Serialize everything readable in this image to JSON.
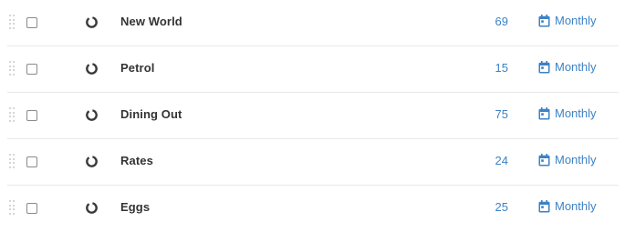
{
  "colors": {
    "accent": "#3d82c4",
    "name_text": "#333333",
    "divider": "#e8e8e8",
    "handle": "#c9c9c9",
    "progress_ring": "#3a3a3a"
  },
  "icons": {
    "drag": "drag-handle-icon",
    "status": "progress-ring-icon",
    "frequency": "calendar-icon"
  },
  "rows": [
    {
      "name": "New World",
      "amount": "69",
      "frequency": "Monthly"
    },
    {
      "name": "Petrol",
      "amount": "15",
      "frequency": "Monthly"
    },
    {
      "name": "Dining Out",
      "amount": "75",
      "frequency": "Monthly"
    },
    {
      "name": "Rates",
      "amount": "24",
      "frequency": "Monthly"
    },
    {
      "name": "Eggs",
      "amount": "25",
      "frequency": "Monthly"
    }
  ]
}
